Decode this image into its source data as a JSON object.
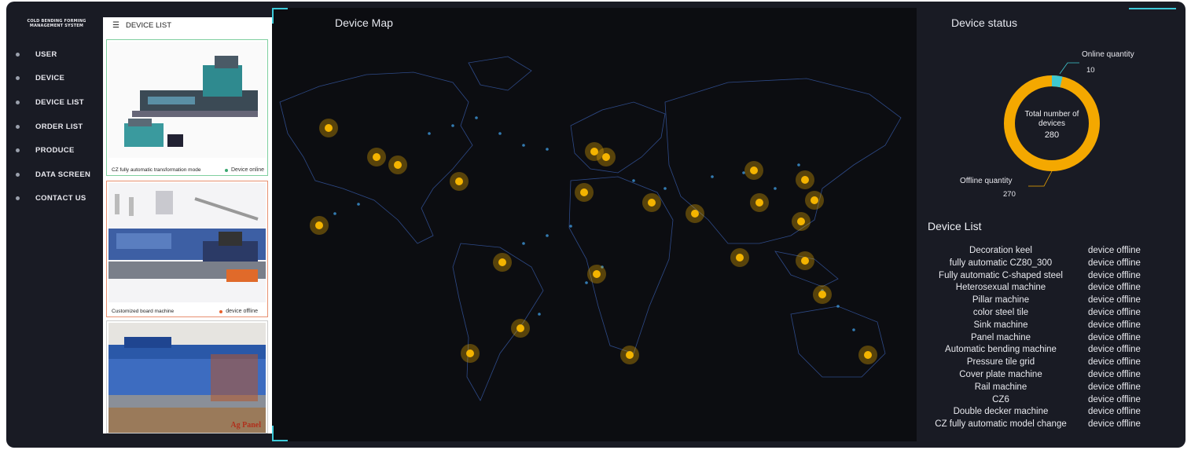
{
  "app": {
    "logo_text": "COLD BENDING FORMING MANAGEMENT SYSTEM"
  },
  "sidebar": {
    "items": [
      {
        "label": "USER"
      },
      {
        "label": "DEVICE"
      },
      {
        "label": "DEVICE LIST"
      },
      {
        "label": "ORDER LIST"
      },
      {
        "label": "PRODUCE"
      },
      {
        "label": "DATA SCREEN"
      },
      {
        "label": "CONTACT US"
      }
    ]
  },
  "device_panel": {
    "title": "DEVICE LIST",
    "menu_icon": "hamburger-icon",
    "cards": [
      {
        "caption": "CZ fully automatic transformation mode",
        "status": "Device online",
        "status_color": "#3aa870"
      },
      {
        "caption": "Customized board machine",
        "status": "device offline",
        "status_color": "#e8602c"
      },
      {
        "caption": "",
        "status": "",
        "image_text": "Ag Panel"
      }
    ]
  },
  "map": {
    "title": "Device Map",
    "accent": "#3cc9d8",
    "marker_color": "#e8a800"
  },
  "status": {
    "title": "Device status",
    "online_label": "Online quantity",
    "online_value": "10",
    "offline_label": "Offline quantity",
    "offline_value": "270",
    "center_label": "Total number of devices",
    "center_value": "280",
    "online_color": "#3ec8d0",
    "offline_color": "#f4a800"
  },
  "device_list": {
    "title": "Device List",
    "rows": [
      {
        "name": "Decoration keel",
        "status": "device offline"
      },
      {
        "name": "fully automatic CZ80_300",
        "status": "device offline"
      },
      {
        "name": "Fully automatic C-shaped steel",
        "status": "device offline"
      },
      {
        "name": "Heterosexual machine",
        "status": "device offline"
      },
      {
        "name": "Pillar machine",
        "status": "device offline"
      },
      {
        "name": "color steel tile",
        "status": "device offline"
      },
      {
        "name": "Sink machine",
        "status": "device offline"
      },
      {
        "name": "Panel machine",
        "status": "device offline"
      },
      {
        "name": "Automatic bending machine",
        "status": "device offline"
      },
      {
        "name": "Pressure tile grid",
        "status": "device offline"
      },
      {
        "name": "Cover plate machine",
        "status": "device offline"
      },
      {
        "name": "Rail machine",
        "status": "device offline"
      },
      {
        "name": "CZ6",
        "status": "device offline"
      },
      {
        "name": "Double decker machine",
        "status": "device offline"
      },
      {
        "name": "CZ fully automatic model change",
        "status": "device offline"
      }
    ]
  }
}
